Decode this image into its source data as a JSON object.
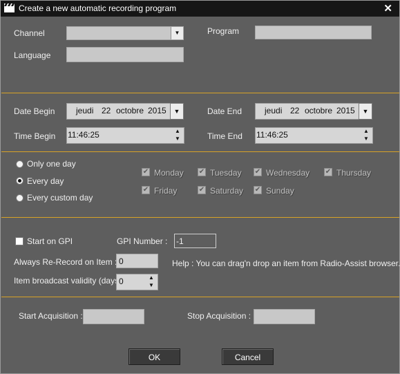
{
  "window": {
    "title": "Create a new automatic recording program",
    "close_glyph": "✕"
  },
  "general": {
    "channel_label": "Channel",
    "channel_value": "",
    "program_label": "Program",
    "program_value": "",
    "language_label": "Language",
    "language_value": ""
  },
  "dates": {
    "date_begin_label": "Date Begin",
    "date_end_label": "Date End",
    "time_begin_label": "Time Begin",
    "time_end_label": "Time End",
    "date_begin": {
      "weekday": "jeudi",
      "day": "22",
      "month": "octobre",
      "year": "2015"
    },
    "date_end": {
      "weekday": "jeudi",
      "day": "22",
      "month": "octobre",
      "year": "2015"
    },
    "time_begin": "11:46:25",
    "time_end": "11:46:25"
  },
  "recurrence": {
    "options": [
      "Only one day",
      "Every day",
      "Every custom day"
    ],
    "selected": "Every day",
    "days": [
      "Monday",
      "Tuesday",
      "Wednesday",
      "Thursday",
      "Friday",
      "Saturday",
      "Sunday"
    ]
  },
  "gpi": {
    "start_on_gpi_label": "Start on GPI",
    "start_on_gpi_checked": false,
    "gpi_number_label": "GPI Number :",
    "gpi_number_value": "-1",
    "always_rerecord_label": "Always Re-Record on Item :",
    "always_rerecord_value": "0",
    "validity_label": "Item broadcast validity (days) :",
    "validity_value": "0",
    "help_text": "Help : You can drag'n drop an item from Radio-Assist browser."
  },
  "acquisition": {
    "start_label": "Start Acquisition :",
    "start_value": "",
    "stop_label": "Stop Acquisition :",
    "stop_value": ""
  },
  "buttons": {
    "ok": "OK",
    "cancel": "Cancel"
  },
  "icons": {
    "spin_up": "▲",
    "spin_down": "▼",
    "dropdown": "▼",
    "check": "✔"
  },
  "colors": {
    "separator": "#d9a326",
    "background": "#5e5e5e",
    "titlebar": "#161616"
  }
}
